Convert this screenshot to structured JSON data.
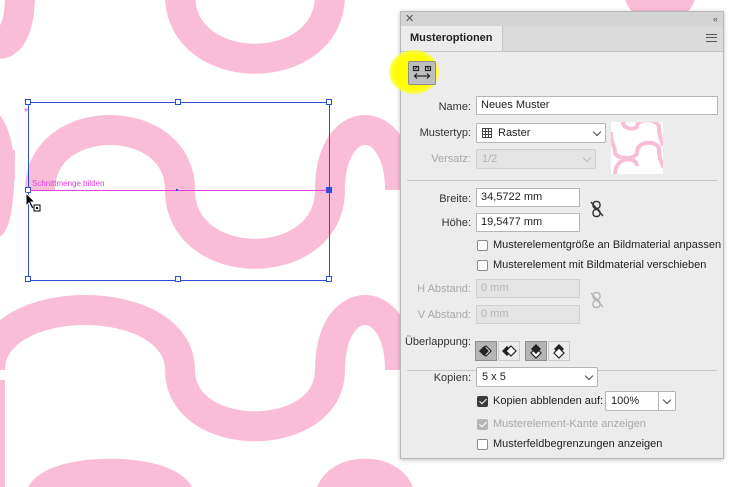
{
  "canvas": {
    "smart_guide_label": "Schnittmenge bilden",
    "pattern_color": "#f9bdd8",
    "selection_color": "#2b4fd8",
    "guide_color": "#e040e0"
  },
  "panel": {
    "close_glyph": "✕",
    "collapse_glyph": "‹‹",
    "tab_label": "Musteroptionen",
    "menu_icon": "menu-icon",
    "tool_icon": "pattern-tile-tool-icon",
    "name_label": "Name:",
    "name_value": "Neues Muster",
    "type_label": "Mustertyp:",
    "type_value": "Raster",
    "brick_label": "Versatz:",
    "brick_value": "1/2",
    "width_label": "Breite:",
    "width_value": "34,5722 mm",
    "height_label": "Höhe:",
    "height_value": "19,5477 mm",
    "size_to_art_label": "Musterelementgröße an Bildmaterial anpassen",
    "size_to_art_checked": false,
    "move_with_art_label": "Musterelement mit Bildmaterial verschieben",
    "move_with_art_checked": false,
    "h_spacing_label": "H Abstand:",
    "h_spacing_placeholder": "0 mm",
    "v_spacing_label": "V Abstand:",
    "v_spacing_placeholder": "0 mm",
    "overlap_label": "Überlappung:",
    "copies_label": "Kopien:",
    "copies_value": "5 x 5",
    "dim_copies_label": "Kopien abblenden auf:",
    "dim_copies_checked": true,
    "dim_copies_value": "100%",
    "show_tile_edge_label": "Musterelement-Kante anzeigen",
    "show_tile_edge_checked": true,
    "show_swatch_bounds_label": "Musterfeldbegrenzungen anzeigen",
    "show_swatch_bounds_checked": false
  }
}
